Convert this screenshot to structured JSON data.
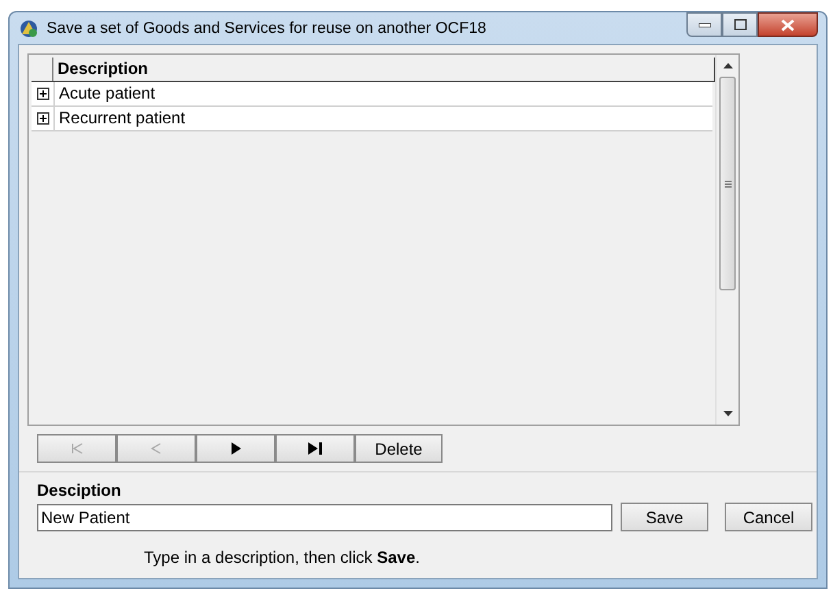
{
  "window": {
    "title": "Save a set of Goods and Services for reuse on another OCF18"
  },
  "table": {
    "columns": [
      "Description"
    ],
    "rows": [
      {
        "description": "Acute patient",
        "expanded": false
      },
      {
        "description": "Recurrent patient",
        "expanded": false
      }
    ]
  },
  "navigator": [
    {
      "kind": "first",
      "disabled": true
    },
    {
      "kind": "prev",
      "disabled": true
    },
    {
      "kind": "next",
      "disabled": false
    },
    {
      "kind": "last",
      "disabled": false
    },
    {
      "kind": "text",
      "label": "Delete",
      "disabled": false
    }
  ],
  "form": {
    "label": "Desciption",
    "value": "New Patient",
    "buttons": [
      "Save",
      "Cancel"
    ],
    "hint": "Type in a description, then click **Save**."
  }
}
